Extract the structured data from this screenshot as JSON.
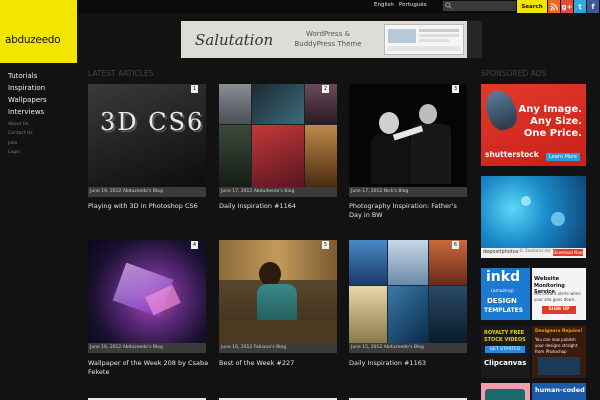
{
  "topbar": {
    "languages": [
      "English",
      "Português"
    ],
    "search_placeholder": "",
    "search_label": "Search",
    "social": [
      {
        "name": "rss",
        "label": "",
        "color": "#f26522"
      },
      {
        "name": "google-plus",
        "label": "g+",
        "color": "#dd4b39"
      },
      {
        "name": "twitter",
        "label": "t",
        "color": "#2fa7e0"
      },
      {
        "name": "facebook",
        "label": "f",
        "color": "#3b5998"
      }
    ]
  },
  "logo": {
    "text": "abduzeedo",
    "background": "#f2e600"
  },
  "banner": {
    "word": "Salutation",
    "line1": "WordPress &",
    "line2": "BuddyPress Theme"
  },
  "nav": {
    "main": [
      "Tutorials",
      "Inspiration",
      "Wallpapers",
      "Interviews"
    ],
    "sub": [
      "About Us",
      "Contact Us",
      "Jobs",
      "Login"
    ]
  },
  "sections": {
    "latest": "LATEST ARTICLES",
    "sponsored": "SPONSORED ADS"
  },
  "articles": [
    {
      "badge": "1",
      "meta": "June 19, 2012  Abduzeedo's Blog",
      "title": "Playing with 3D in Photoshop CS6",
      "thumb_text": "3D CS6"
    },
    {
      "badge": "2",
      "meta": "June 17, 2012  Abdu4eedo's Blog",
      "title": "Daily Inspiration #1164"
    },
    {
      "badge": "3",
      "meta": "June 17, 2012  Nick's Blog",
      "title": "Photography Inspiration: Father's Day in BW"
    },
    {
      "badge": "4",
      "meta": "June 16, 2012  Abduzeedo's Blog",
      "title": "Wallpaper of the Week 208 by Csaba Fekete"
    },
    {
      "badge": "5",
      "meta": "June 16, 2012  Fabiano's Blog",
      "title": "Best of the Week #227"
    },
    {
      "badge": "6",
      "meta": "June 15, 2012  Abduzeedo's Blog",
      "title": "Daily Inspiration #1163"
    }
  ],
  "ads": {
    "shutterstock": {
      "l1": "Any Image.",
      "l2": "Any Size.",
      "l3": "One Price.",
      "brand": "shutterstock",
      "cta": "Learn More"
    },
    "depositphotos": {
      "brand": "depositphotos",
      "handle": "© 2solarcs.mr",
      "cta": "Download Now"
    },
    "inkd": {
      "brand": "inkd",
      "l1": "(amazing)",
      "l2": "DESIGN",
      "l3": "TEMPLATES"
    },
    "monitoring": {
      "l1": "Website",
      "l2": "Monitoring Service",
      "l3": "Get instant alerts when",
      "l4": "your site goes down.",
      "cta": "SIGN UP NOW!"
    },
    "clipcanvas": {
      "l1": "ROYALTY FREE",
      "l2": "STOCK VIDEOS",
      "cta": "GET STARTED",
      "brand": "Clipcanvas"
    },
    "designers": {
      "l1": "Designers Rejoice!",
      "l2": "You can now publish",
      "l3": "your designs straight",
      "l4": "from Photoshop"
    },
    "humancoded": {
      "l1": "human-coded"
    }
  }
}
